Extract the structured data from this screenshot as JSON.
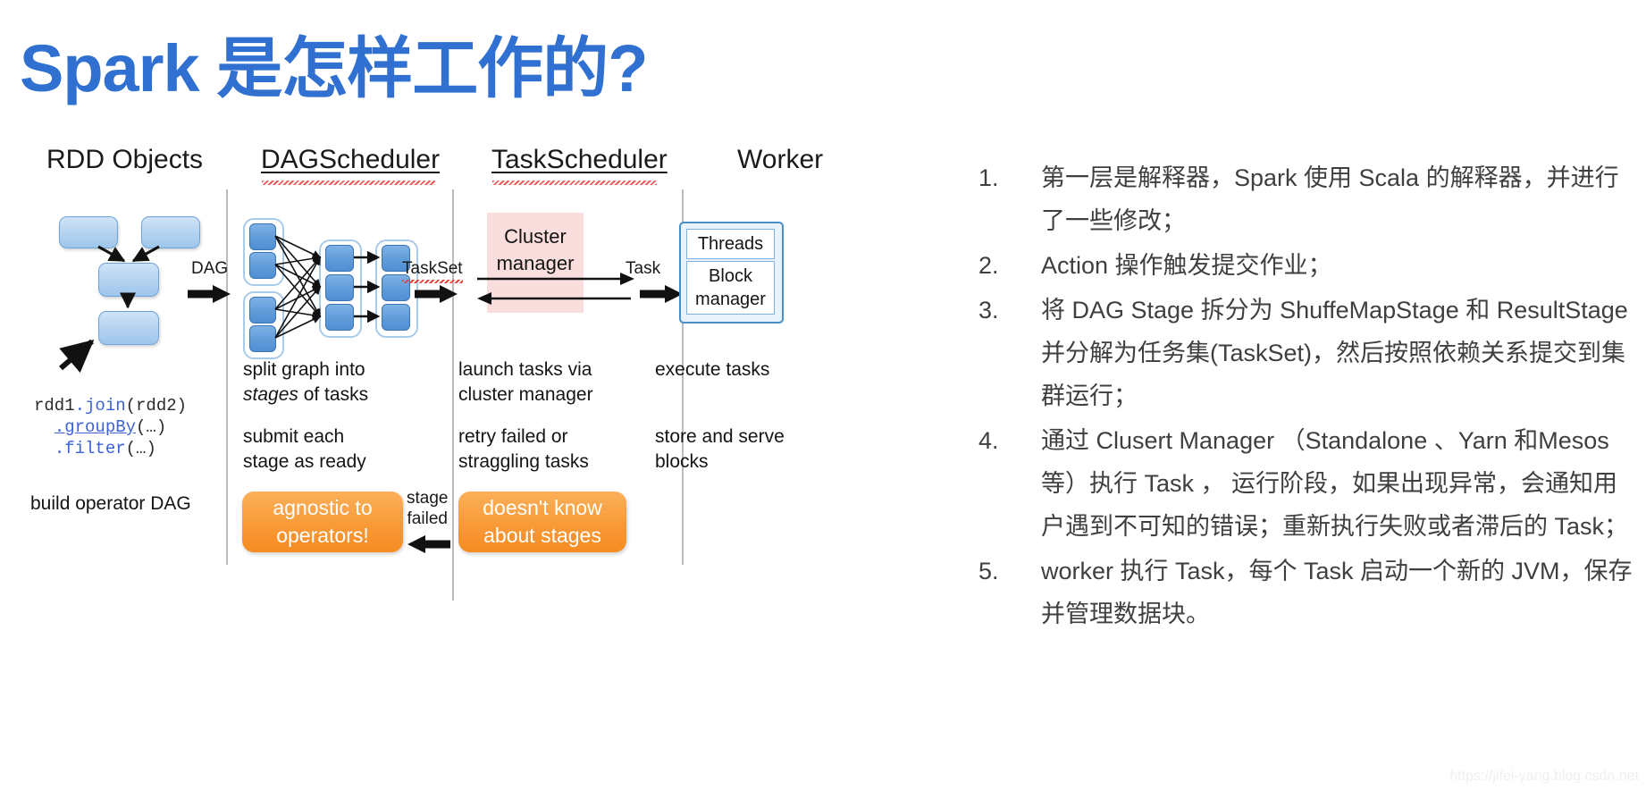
{
  "title": "Spark 是怎样工作的?",
  "colors": {
    "title_blue": "#3070d0",
    "node_blue": "#5d9ad9",
    "rdd_blue": "#b3d2f0",
    "orange": "#f89a37",
    "cluster_pink": "#f9dedd",
    "list_text": "#3f3f3f"
  },
  "diagram": {
    "columns": [
      {
        "heading": "RDD Objects"
      },
      {
        "heading": "DAGScheduler"
      },
      {
        "heading": "TaskScheduler"
      },
      {
        "heading": "Worker"
      }
    ],
    "flow_labels": [
      {
        "text": "DAG"
      },
      {
        "text": "TaskSet"
      },
      {
        "text": "Task"
      },
      {
        "text": "stage\nfailed"
      }
    ],
    "code": {
      "line1_a": "rdd1",
      "line1_b": ".join",
      "line1_c": "(rdd2)",
      "line2_a": ".groupBy",
      "line2_b": "(…)",
      "line3_a": ".filter",
      "line3_b": "(…)"
    },
    "captions": {
      "rdd_build": "build operator DAG",
      "dag_line1_a": "split graph into\n",
      "dag_line1_b": "stages",
      "dag_line1_c": " of tasks",
      "dag_line2": "submit each\nstage as ready",
      "task_line1": "launch tasks via\ncluster manager",
      "task_line2": "retry failed or\nstraggling tasks",
      "worker_line1": "execute tasks",
      "worker_line2": "store and serve\nblocks"
    },
    "cluster_manager": "Cluster\nmanager",
    "worker_boxes": [
      {
        "label": "Threads"
      },
      {
        "label": "Block\nmanager"
      }
    ],
    "orange_boxes": [
      {
        "label": "agnostic to\noperators!"
      },
      {
        "label": "doesn't know\nabout stages"
      }
    ]
  },
  "list": {
    "items": [
      {
        "num": "1.",
        "text": "第一层是解释器，Spark 使用 Scala 的解释器，并进行了一些修改；"
      },
      {
        "num": "2.",
        "text": "Action 操作触发提交作业；"
      },
      {
        "num": "3.",
        "text": "将 DAG Stage 拆分为 ShuffeMapStage 和 ResultStage并分解为任务集(TaskSet)，然后按照依赖关系提交到集群运行；"
      },
      {
        "num": "4.",
        "text": "通过 Clusert Manager （Standalone 、Yarn 和Mesos等）执行 Task ， 运行阶段，如果出现异常，会通知用户遇到不可知的错误；重新执行失败或者滞后的 Task；"
      },
      {
        "num": "5.",
        "text": "worker 执行 Task，每个 Task 启动一个新的 JVM，保存并管理数据块。"
      }
    ]
  },
  "watermark": "https://jifei-yang.blog.csdn.net"
}
